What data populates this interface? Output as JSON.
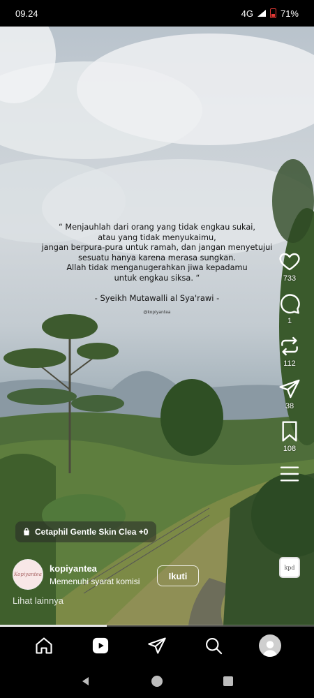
{
  "status": {
    "time": "09.24",
    "network": "4G",
    "battery": "71%"
  },
  "reel": {
    "quote_lines": [
      "“ Menjauhlah dari orang yang tidak engkau sukai,",
      "atau yang tidak menyukaimu,",
      "jangan berpura-pura untuk ramah, dan jangan menyetujui",
      "sesuatu hanya karena merasa sungkan.",
      "Allah tidak menganugerahkan jiwa kepadamu",
      "untuk engkau siksa. “"
    ],
    "author": "- Syeikh Mutawalli al Sya'rawi -",
    "watermark": "@kopiyantea"
  },
  "actions": {
    "likes": "733",
    "comments": "1",
    "reposts": "112",
    "shares": "38",
    "saves": "108"
  },
  "audio_thumb_text": "kpd",
  "product_tag": "Cetaphil Gentle Skin Clea +0",
  "creator": {
    "avatar_text": "Kopiyantea",
    "username": "kopiyantea",
    "subtitle": "Memenuhi syarat komisi",
    "follow_label": "Ikuti",
    "see_more": "Lihat lainnya"
  },
  "progress": 0.34,
  "bottom_nav": [
    "home-icon",
    "reels-icon",
    "direct-send-icon",
    "search-icon",
    "profile-avatar"
  ]
}
